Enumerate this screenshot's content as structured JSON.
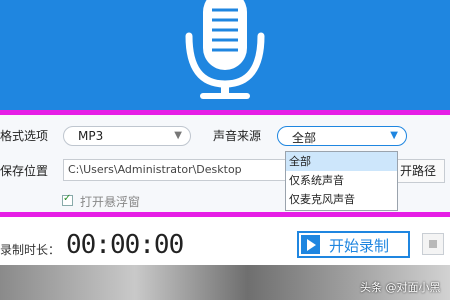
{
  "colors": {
    "header_bg": "#1f86e0",
    "magenta_divider": "#e61ee6",
    "accent": "#1f86e0"
  },
  "icons": {
    "microphone": "microphone-icon",
    "dropdown_chevron": "chevron-down-icon",
    "play": "play-icon",
    "stop": "stop-icon"
  },
  "settings": {
    "format_label": "格式选项",
    "format_value": "MP3",
    "source_label": "声音来源",
    "source_value": "全部",
    "save_label": "保存位置",
    "save_path": "C:\\Users\\Administrator\\Desktop",
    "change_path_button": "开路径",
    "floating_window_label": "打开悬浮窗",
    "floating_window_checked": true
  },
  "source_dropdown": {
    "options": [
      "全部",
      "仅系统声音",
      "仅麦克风声音"
    ],
    "selected_index": 0
  },
  "recording": {
    "duration_label": "录制时长：",
    "duration_value": "00:00:00",
    "start_button": "开始录制"
  },
  "watermark": "头条 @对面小黑"
}
